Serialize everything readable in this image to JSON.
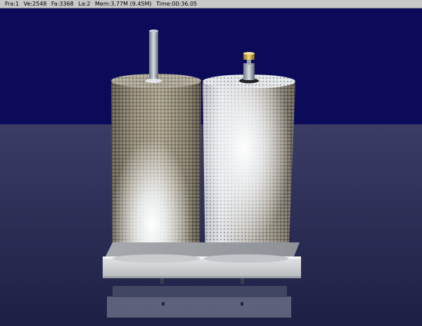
{
  "status": {
    "frame": "Fra:1",
    "vertices": "Ve:2548",
    "faces": "Fa:3368",
    "lamps": "La:2",
    "memory": "Mem:3.77M (9.45M)",
    "time": "Time:00:36.05"
  },
  "scene": {
    "background_color": "#0b0b5a",
    "floor_color": "#2b2c55",
    "left_canister_color": "#8c8471",
    "right_canister_color": "#cdd0d4",
    "base_plate_color": "#d8dadc"
  }
}
